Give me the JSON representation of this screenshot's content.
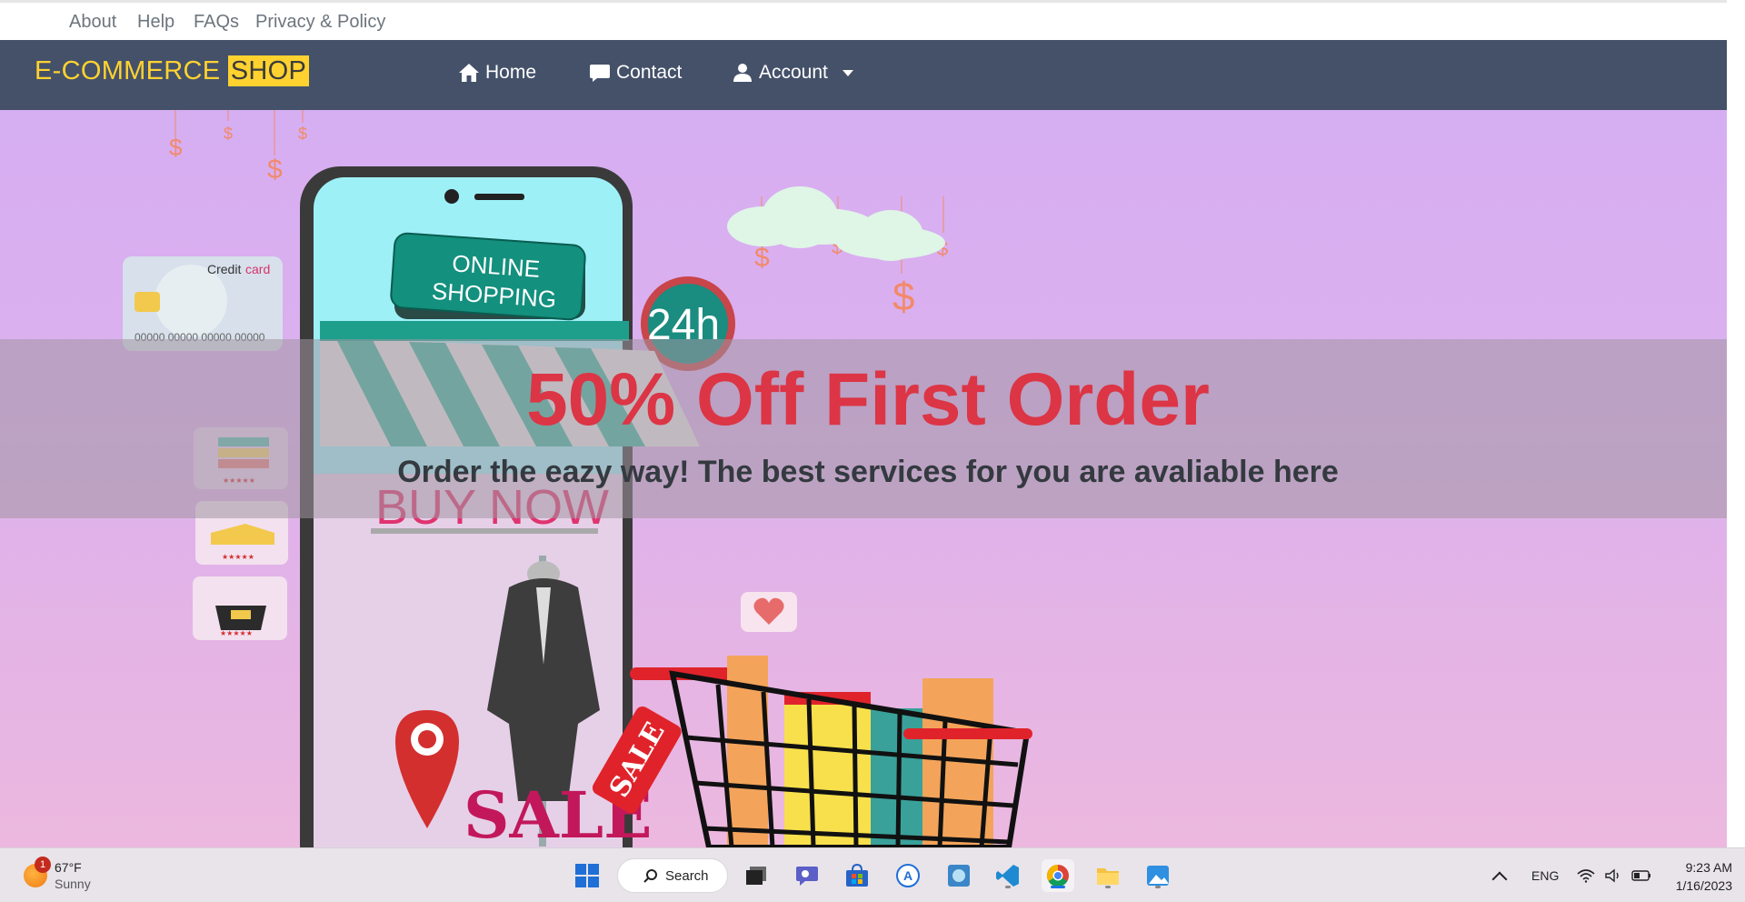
{
  "toplinks": {
    "about": "About",
    "help": "Help",
    "faqs": "FAQs",
    "privacy": "Privacy & Policy"
  },
  "navbar": {
    "brand_main": "E-COMMERCE",
    "brand_highlight": "SHOP",
    "home": "Home",
    "contact": "Contact",
    "account": "Account"
  },
  "hero": {
    "title": "50% Off First Order",
    "subtitle": "Order the eazy way! The best services for you are avaliable here",
    "illustration": {
      "sign_line1": "ONLINE",
      "sign_line2": "SHOPPING",
      "badge": "24h",
      "buy_now": "BUY NOW",
      "card_label": "Credit",
      "card_label_accent": "card",
      "card_number": "00000 00000 00000 00000",
      "sale_tag": "SALE",
      "sale_letters": "SALE"
    }
  },
  "taskbar": {
    "weather_temp": "67°F",
    "weather_desc": "Sunny",
    "weather_badge": "1",
    "search_label": "Search",
    "lang": "ENG",
    "time": "9:23 AM",
    "date": "1/16/2023"
  },
  "colors": {
    "navbar": "#445169",
    "brand": "#ffd230",
    "banner_title": "#dc3545",
    "banner_subtitle": "#343a40",
    "hero_top": "#d6aef2",
    "hero_bottom": "#ecb8df"
  }
}
